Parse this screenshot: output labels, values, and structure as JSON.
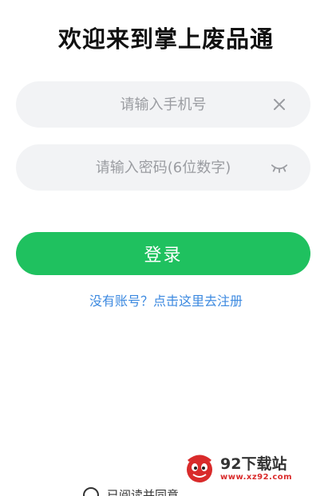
{
  "title": "欢迎来到掌上废品通",
  "form": {
    "phone": {
      "placeholder": "请输入手机号",
      "value": "",
      "trailing_icon": "clear-icon"
    },
    "password": {
      "placeholder": "请输入密码(6位数字)",
      "value": "",
      "trailing_icon": "eye-closed-icon"
    },
    "login_label": "登录",
    "register_link": "没有账号？点击这里去注册"
  },
  "footer": {
    "agreement_text": "已阅读并同意",
    "agreement_icon": "checkbox-circle-icon"
  },
  "watermark": {
    "name": "92下载站",
    "url": "www.xz92.com"
  },
  "colors": {
    "primary": "#1fc15f",
    "link": "#3d8ae0",
    "field_bg": "#f2f3f5",
    "placeholder": "#9a9ca1"
  }
}
